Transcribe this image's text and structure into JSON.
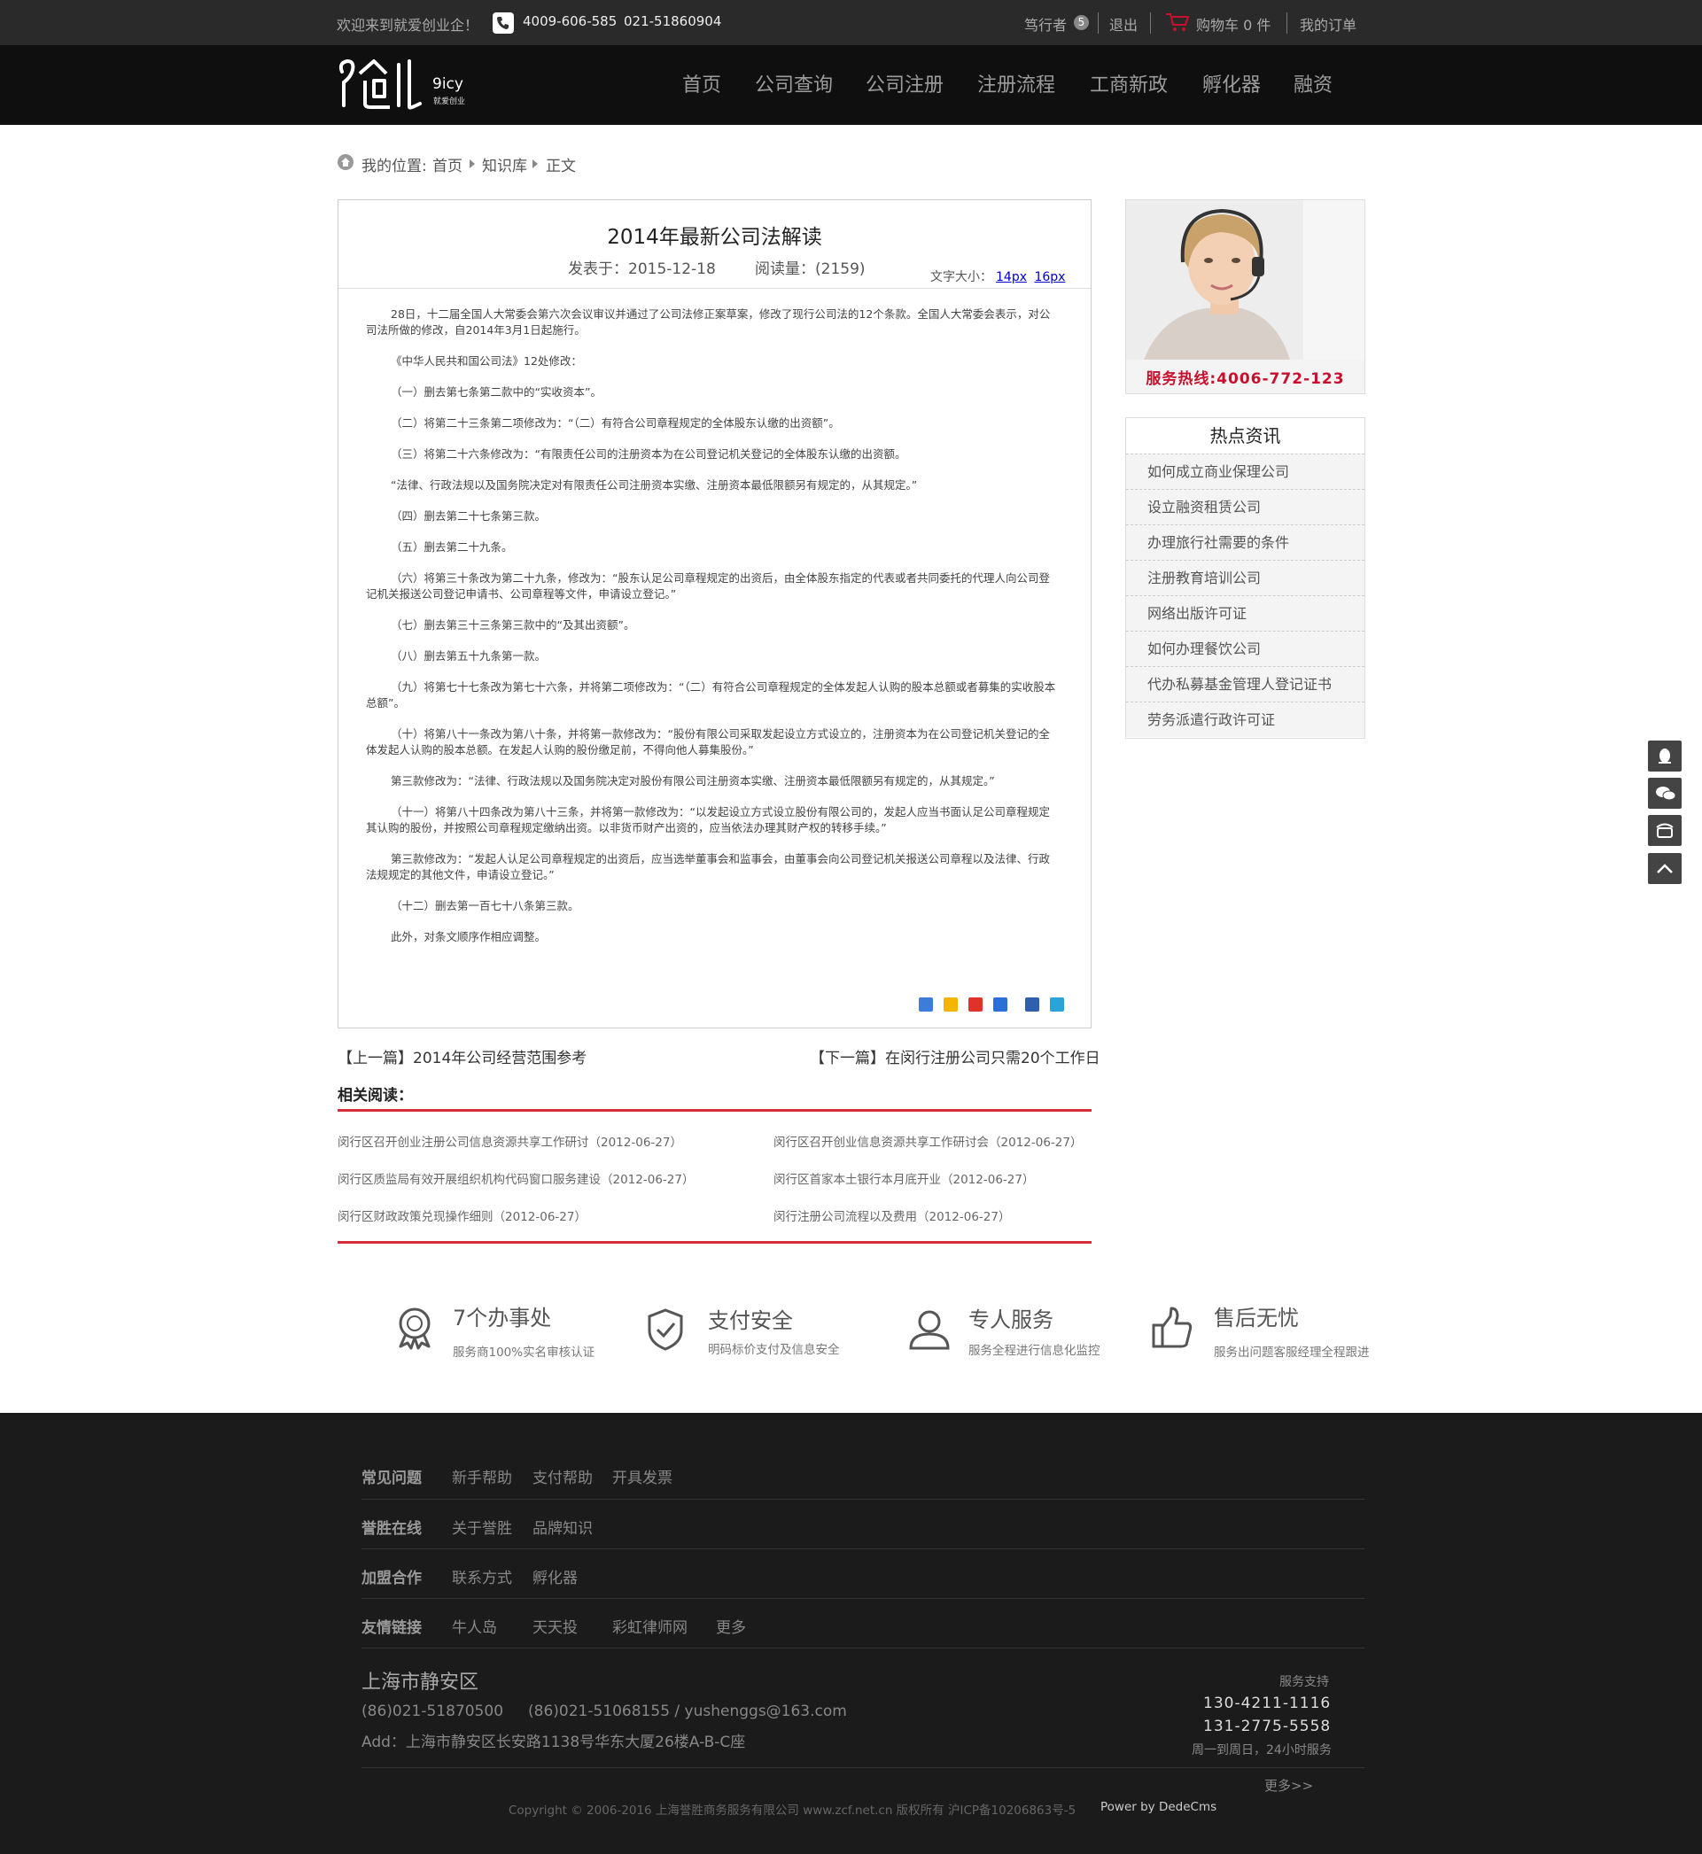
{
  "topbar": {
    "welcome": "欢迎来到就爱创业企！",
    "phone1": "4009-606-585",
    "phone2": "021-51860904",
    "user": "笃行者",
    "user_badge": "5",
    "logout": "退出",
    "cart": "购物车 0 件",
    "orders": "我的订单"
  },
  "logo": {
    "main": "创业",
    "en": "9icy",
    "sub": "就爱创业"
  },
  "nav": [
    "首页",
    "公司查询",
    "公司注册",
    "注册流程",
    "工商新政",
    "孵化器",
    "融资"
  ],
  "breadcrumb": {
    "label": "我的位置:",
    "home": "首页",
    "kb": "知识库",
    "current": "正文"
  },
  "article": {
    "title": "2014年最新公司法解读",
    "date": "发表于：2015-12-18",
    "views": "阅读量：(2159)",
    "font_label": "文字大小：",
    "font_14": "14px",
    "font_16": "16px",
    "paragraphs": [
      "28日，十二届全国人大常委会第六次会议审议并通过了公司法修正案草案，修改了现行公司法的12个条款。全国人大常委会表示，对公司法所做的修改，自2014年3月1日起施行。",
      "《中华人民共和国公司法》12处修改：",
      "（一）删去第七条第二款中的“实收资本”。",
      "（二）将第二十三条第二项修改为：“（二）有符合公司章程规定的全体股东认缴的出资额”。",
      "（三）将第二十六条修改为：“有限责任公司的注册资本为在公司登记机关登记的全体股东认缴的出资额。",
      "“法律、行政法规以及国务院决定对有限责任公司注册资本实缴、注册资本最低限额另有规定的，从其规定。”",
      "（四）删去第二十七条第三款。",
      "（五）删去第二十九条。",
      "（六）将第三十条改为第二十九条，修改为：“股东认足公司章程规定的出资后，由全体股东指定的代表或者共同委托的代理人向公司登记机关报送公司登记申请书、公司章程等文件，申请设立登记。”",
      "（七）删去第三十三条第三款中的“及其出资额”。",
      "（八）删去第五十九条第一款。",
      "（九）将第七十七条改为第七十六条，并将第二项修改为：“（二）有符合公司章程规定的全体发起人认购的股本总额或者募集的实收股本总额”。",
      "（十）将第八十一条改为第八十条，并将第一款修改为：“股份有限公司采取发起设立方式设立的，注册资本为在公司登记机关登记的全体发起人认购的股本总额。在发起人认购的股份缴足前，不得向他人募集股份。”",
      "第三款修改为：“法律、行政法规以及国务院决定对股份有限公司注册资本实缴、注册资本最低限额另有规定的，从其规定。”",
      "（十一）将第八十四条改为第八十三条，并将第一款修改为：“以发起设立方式设立股份有限公司的，发起人应当书面认足公司章程规定其认购的股份，并按照公司章程规定缴纳出资。以非货币财产出资的，应当依法办理其财产权的转移手续。”",
      "第三款修改为：“发起人认足公司章程规定的出资后，应当选举董事会和监事会，由董事会向公司登记机关报送公司章程以及法律、行政法规规定的其他文件，申请设立登记。”",
      "（十二）删去第一百七十八条第三款。",
      "此外，对条文顺序作相应调整。"
    ]
  },
  "prev": "【上一篇】2014年公司经营范围参考",
  "next": "【下一篇】在闵行注册公司只需20个工作日",
  "related": {
    "title": "相关阅读：",
    "items": [
      "闵行区召开创业注册公司信息资源共享工作研讨（2012-06-27）",
      "闵行区召开创业信息资源共享工作研讨会（2012-06-27）",
      "闵行区质监局有效开展组织机构代码窗口服务建设（2012-06-27）",
      "闵行区首家本土银行本月底开业（2012-06-27）",
      "闵行区财政政策兑现操作细则（2012-06-27）",
      "闵行注册公司流程以及费用（2012-06-27）"
    ]
  },
  "sidebar": {
    "hotline": "服务热线:4006-772-123",
    "hot_title": "热点资讯",
    "hot_items": [
      "如何成立商业保理公司",
      "设立融资租赁公司",
      "办理旅行社需要的条件",
      "注册教育培训公司",
      "网络出版许可证",
      "如何办理餐饮公司",
      "代办私募基金管理人登记证书",
      "劳务派遣行政许可证"
    ]
  },
  "features": [
    {
      "title": "7个办事处",
      "sub": "服务商100%实名审核认证",
      "icon": "badge-icon"
    },
    {
      "title": "支付安全",
      "sub": "明码标价支付及信息安全",
      "icon": "shield-icon"
    },
    {
      "title": "专人服务",
      "sub": "服务全程进行信息化监控",
      "icon": "user-icon"
    },
    {
      "title": "售后无忧",
      "sub": "服务出问题客服经理全程跟进",
      "icon": "thumbs-up-icon"
    }
  ],
  "footer": {
    "rows": [
      {
        "label": "常见问题",
        "links": [
          "新手帮助",
          "支付帮助",
          "开具发票"
        ]
      },
      {
        "label": "誉胜在线",
        "links": [
          "关于誉胜",
          "品牌知识"
        ]
      },
      {
        "label": "加盟合作",
        "links": [
          "联系方式",
          "孵化器"
        ]
      },
      {
        "label": "友情链接",
        "links": [
          "牛人岛",
          "天天投",
          "彩虹律师网",
          "更多"
        ]
      }
    ],
    "city": "上海市静安区",
    "phones": "(86)021-51870500",
    "phones2": "(86)021-51068155 / yushenggs@163.com",
    "address": "Add：上海市静安区长安路1138号华东大厦26楼A-B-C座",
    "support_label": "服务支持",
    "support1": "130-4211-1116",
    "support2": "131-2775-5558",
    "support_hours": "周一到周日，24小时服务",
    "more": "更多>>",
    "copyright": "Copyright © 2006-2016 上海誉胜商务服务有限公司 www.zcf.net.cn  版权所有  沪ICP备10206863号-5",
    "powered": "Power by DedeCms"
  },
  "colors": {
    "accent_red": "#c8102e",
    "topbar": "#2a2a2a",
    "nav": "#0f0f0f",
    "footer": "#1b1b1b"
  }
}
